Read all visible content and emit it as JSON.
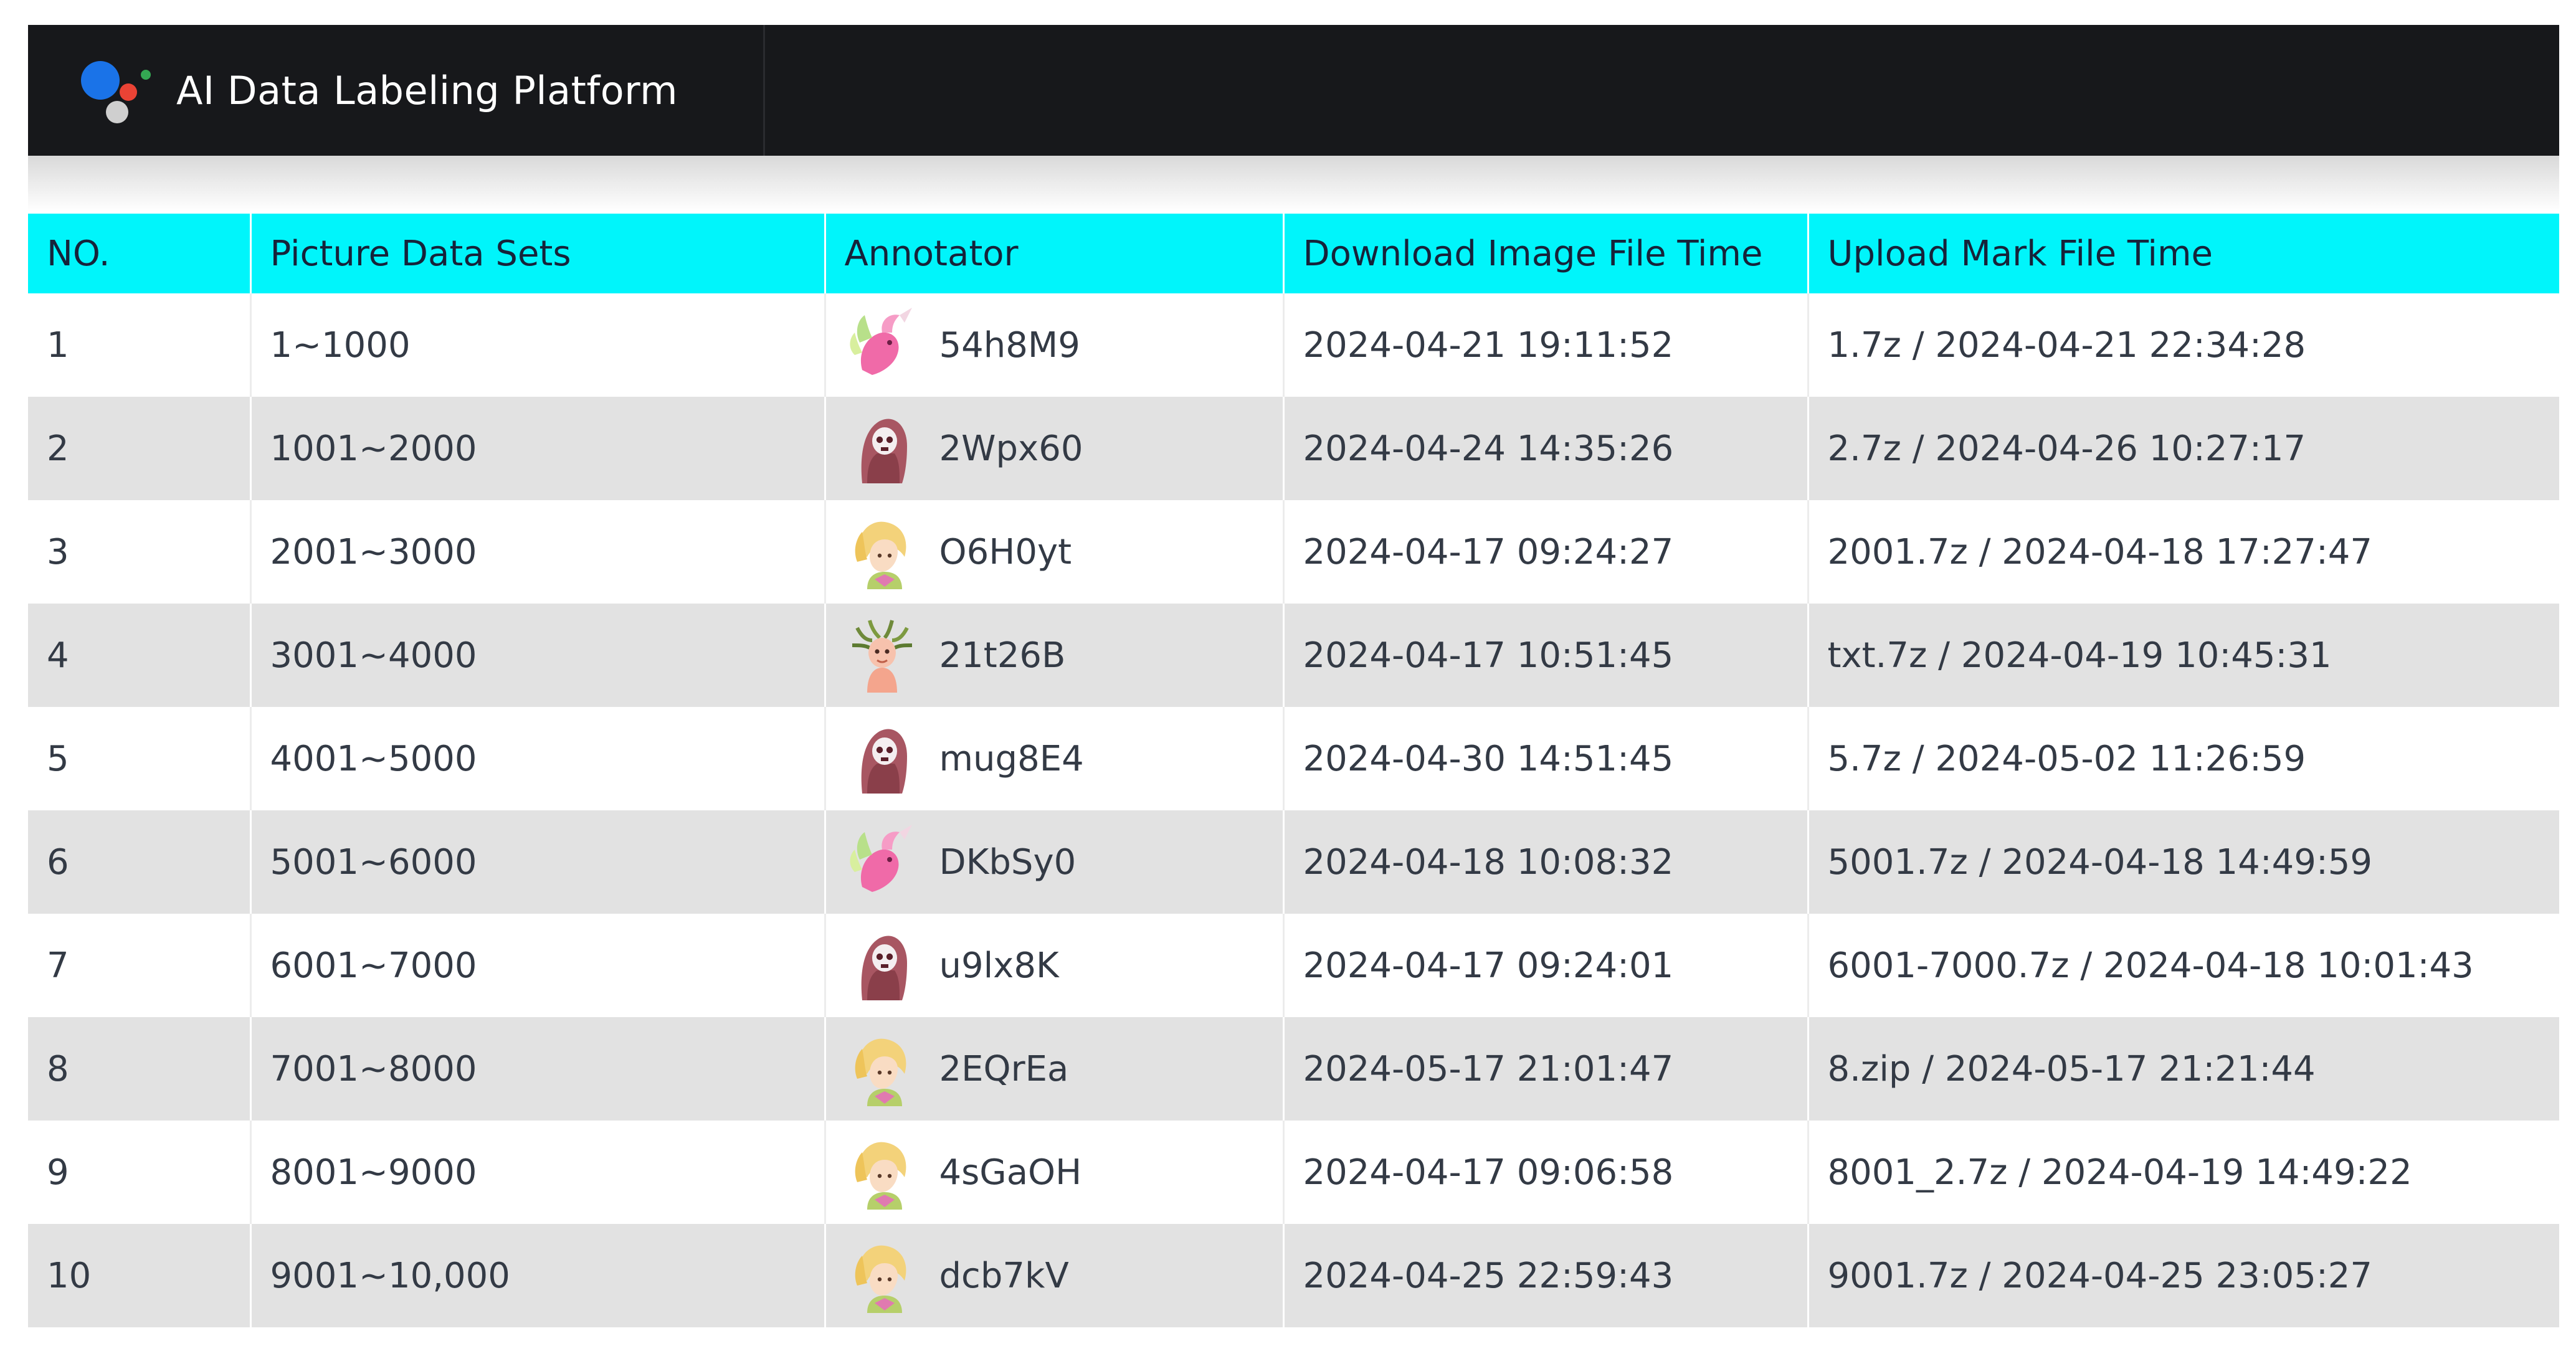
{
  "app": {
    "title": "AI Data Labeling Platform"
  },
  "table": {
    "headers": {
      "no": "NO.",
      "sets": "Picture Data Sets",
      "annotator": "Annotator",
      "download": "Download Image File Time",
      "upload": "Upload Mark File Time"
    },
    "rows": [
      {
        "no": "1",
        "sets": "1~1000",
        "avatar": "pink-unicorn-avatar",
        "annotator": "54h8M9",
        "download": "2024-04-21 19:11:52",
        "upload": "1.7z / 2024-04-21 22:34:28"
      },
      {
        "no": "2",
        "sets": "1001~2000",
        "avatar": "hooded-skull-avatar",
        "annotator": "2Wpx60",
        "download": "2024-04-24 14:35:26",
        "upload": "2.7z / 2024-04-26 10:27:17"
      },
      {
        "no": "3",
        "sets": "2001~3000",
        "avatar": "blonde-girl-avatar",
        "annotator": "O6H0yt",
        "download": "2024-04-17 09:24:27",
        "upload": "2001.7z / 2024-04-18 17:27:47"
      },
      {
        "no": "4",
        "sets": "3001~4000",
        "avatar": "medusa-avatar",
        "annotator": "21t26B",
        "download": "2024-04-17 10:51:45",
        "upload": "txt.7z / 2024-04-19 10:45:31"
      },
      {
        "no": "5",
        "sets": "4001~5000",
        "avatar": "hooded-skull-avatar",
        "annotator": "mug8E4",
        "download": "2024-04-30 14:51:45",
        "upload": "5.7z / 2024-05-02 11:26:59"
      },
      {
        "no": "6",
        "sets": "5001~6000",
        "avatar": "pink-unicorn-avatar",
        "annotator": "DKbSy0",
        "download": "2024-04-18 10:08:32",
        "upload": "5001.7z / 2024-04-18 14:49:59"
      },
      {
        "no": "7",
        "sets": "6001~7000",
        "avatar": "hooded-skull-avatar",
        "annotator": "u9lx8K",
        "download": "2024-04-17 09:24:01",
        "upload": "6001-7000.7z / 2024-04-18 10:01:43"
      },
      {
        "no": "8",
        "sets": "7001~8000",
        "avatar": "blonde-girl-avatar",
        "annotator": "2EQrEa",
        "download": "2024-05-17 21:01:47",
        "upload": "8.zip / 2024-05-17 21:21:44"
      },
      {
        "no": "9",
        "sets": "8001~9000",
        "avatar": "blonde-girl-avatar",
        "annotator": "4sGaOH",
        "download": "2024-04-17 09:06:58",
        "upload": "8001_2.7z / 2024-04-19 14:49:22"
      },
      {
        "no": "10",
        "sets": "9001~10,000",
        "avatar": "blonde-girl-avatar",
        "annotator": "dcb7kV",
        "download": "2024-04-25 22:59:43",
        "upload": "9001.7z / 2024-04-25 23:05:27"
      }
    ]
  },
  "colors": {
    "topbar": "#17181b",
    "header_row": "#00f5fb",
    "row_stripe": "#e2e2e2"
  }
}
